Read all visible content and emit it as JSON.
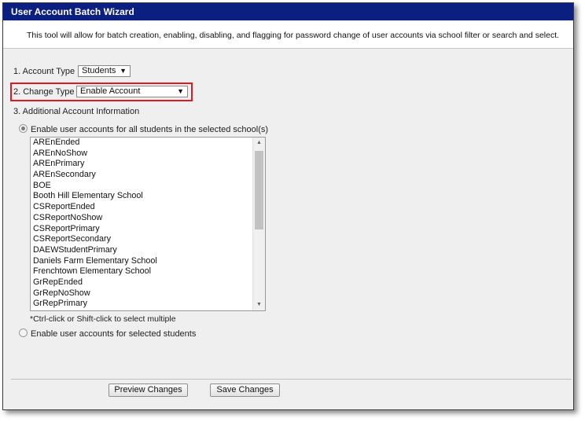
{
  "window": {
    "title": "User Account Batch Wizard"
  },
  "description": "This tool will allow for batch creation, enabling, disabling, and flagging for password change of user accounts via school filter or search and select.",
  "form": {
    "account_type": {
      "label": "1. Account Type",
      "value": "Students"
    },
    "change_type": {
      "label": "2. Change Type",
      "value": "Enable Account"
    },
    "additional_info": {
      "label": "3. Additional Account Information"
    }
  },
  "options": {
    "all_students": {
      "label": "Enable user accounts for all students in the selected school(s)",
      "checked": true
    },
    "selected_students": {
      "label": "Enable user accounts for selected students",
      "checked": false
    }
  },
  "schools": [
    "AREnEnded",
    "AREnNoShow",
    "AREnPrimary",
    "AREnSecondary",
    "BOE",
    "Booth Hill Elementary School",
    "CSReportEnded",
    "CSReportNoShow",
    "CSReportPrimary",
    "CSReportSecondary",
    "DAEWStudentPrimary",
    "Daniels Farm Elementary School",
    "Frenchtown Elementary School",
    "GrRepEnded",
    "GrRepNoShow",
    "GrRepPrimary"
  ],
  "hint": "*Ctrl-click or Shift-click to select multiple",
  "buttons": {
    "preview": "Preview Changes",
    "save": "Save Changes"
  },
  "colors": {
    "title_bar": "#0a1f80",
    "highlight": "#e0181f",
    "panel": "#efefef"
  },
  "icons": {
    "dropdown": "triangle-down-icon",
    "scroll_up": "chevron-up-icon",
    "scroll_down": "chevron-down-icon"
  }
}
